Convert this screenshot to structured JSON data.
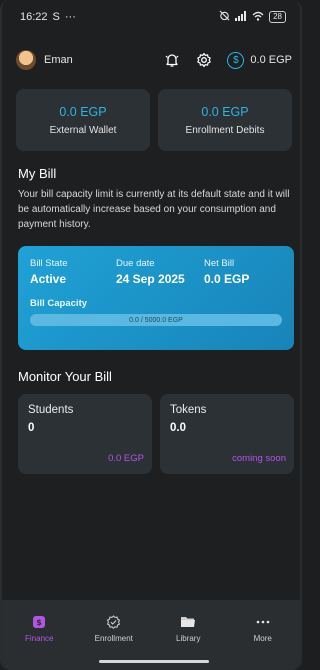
{
  "status_bar": {
    "time": "16:22",
    "carrier_glyph": "S",
    "more": "···",
    "battery": "28"
  },
  "header": {
    "username": "Eman",
    "balance": "0.0 EGP",
    "currency_symbol": "$"
  },
  "wallet_cards": [
    {
      "amount": "0.0 EGP",
      "label": "External Wallet"
    },
    {
      "amount": "0.0 EGP",
      "label": "Enrollment Debits"
    }
  ],
  "my_bill": {
    "title": "My Bill",
    "description": "Your bill capacity limit is currently at its default state and it will be automatically increase based on your consumption and payment history.",
    "state_label": "Bill State",
    "state_value": "Active",
    "due_label": "Due date",
    "due_value": "24 Sep 2025",
    "net_label": "Net Bill",
    "net_value": "0.0 EGP",
    "capacity_label": "Bill Capacity",
    "capacity_text": "0.0 / 5000.0 EGP",
    "capacity_fraction": 0.0
  },
  "monitor": {
    "title": "Monitor Your Bill",
    "cards": [
      {
        "title": "Students",
        "value": "0",
        "footer": "0.0 EGP"
      },
      {
        "title": "Tokens",
        "value": "0.0",
        "footer": "coming soon"
      }
    ]
  },
  "bottom_nav": [
    {
      "label": "Finance",
      "icon": "finance-icon",
      "active": true
    },
    {
      "label": "Enrollment",
      "icon": "check-badge-icon",
      "active": false
    },
    {
      "label": "Library",
      "icon": "folder-icon",
      "active": false
    },
    {
      "label": "More",
      "icon": "more-dots-icon",
      "active": false
    }
  ],
  "colors": {
    "accent": "#2fb3e3",
    "purple": "#b255e6",
    "card": "#2c3135",
    "background": "#1d1f21"
  }
}
